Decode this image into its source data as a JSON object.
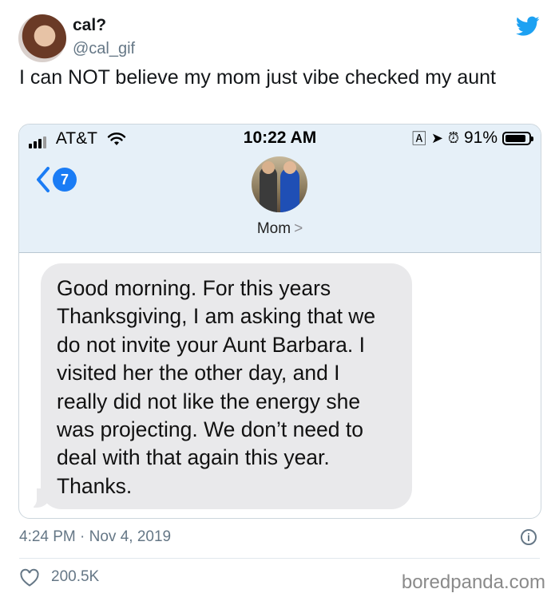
{
  "tweet": {
    "display_name": "cal?",
    "handle": "@cal_gif",
    "text": "I can NOT believe my mom just vibe checked my aunt",
    "timestamp": "4:24 PM · Nov 4, 2019",
    "likes": "200.5K",
    "brand_color": "#1da1f2"
  },
  "phone": {
    "carrier": "AT&T",
    "time": "10:22 AM",
    "battery": "91%",
    "battery_level": 0.91,
    "back_count": "7",
    "contact_name": "Mom",
    "contact_chevron": ">",
    "message": "Good morning. For this years Thanksgiving, I am asking that we do not invite your Aunt Barbara. I visited her the other day, and I really did not like the energy she was projecting. We don’t need to deal with that again this year. Thanks."
  },
  "icons": {
    "status_right": [
      "at-icon",
      "location-icon",
      "alarm-icon"
    ],
    "info": "i"
  },
  "watermark": "boredpanda.com"
}
